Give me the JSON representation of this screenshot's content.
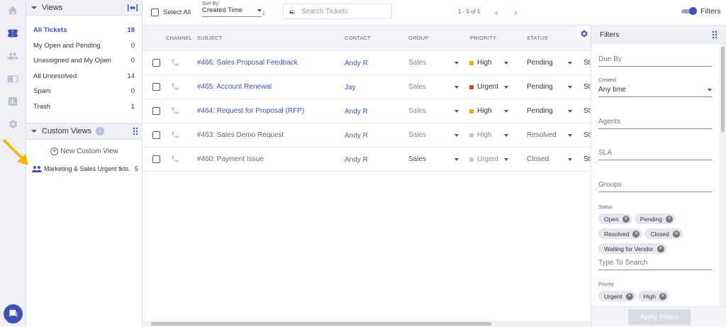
{
  "views": {
    "title": "Views",
    "items": [
      {
        "label": "All Tickets",
        "count": "18"
      },
      {
        "label": "My Open and Pending",
        "count": "0"
      },
      {
        "label": "Unassigned and My Open",
        "count": "0"
      },
      {
        "label": "All Unresolved",
        "count": "14"
      },
      {
        "label": "Spam",
        "count": "0"
      },
      {
        "label": "Trash",
        "count": "1"
      }
    ]
  },
  "custom_views": {
    "title": "Custom Views",
    "info": "i",
    "new_label": "New Custom View",
    "items": [
      {
        "label": "Marketing & Sales Urgent tkts.",
        "count": "5"
      }
    ]
  },
  "toolbar": {
    "select_all": "Select All",
    "sort_caption": "Sort By:",
    "sort_value": "Created Time",
    "sort_direction": "↓",
    "search_placeholder": "Search Tickets",
    "pager": "1 - 5 of 5",
    "prev": "‹",
    "next": "›",
    "filters_label": "Filters"
  },
  "table": {
    "headers": {
      "channel": "CHANNEL",
      "subject": "SUBJECT",
      "contact": "CONTACT",
      "group": "GROUP",
      "priority": "PRIORITY",
      "status": "STATUS"
    },
    "rows": [
      {
        "subject": "#466: Sales Proposal Feedback",
        "contact": "Andy R",
        "group": "Sales",
        "priority": "High",
        "priority_color": "#f5a623",
        "status": "Pending",
        "stcut": "Sta",
        "resolved": false
      },
      {
        "subject": "#465: Account Renewal",
        "contact": "Jay",
        "group": "Sales",
        "priority": "Urgent",
        "priority_color": "#e53935",
        "status": "Pending",
        "stcut": "Sta",
        "resolved": false
      },
      {
        "subject": "#464: Request for Proposal (RFP)",
        "contact": "Andy R",
        "group": "Sales",
        "priority": "High",
        "priority_color": "#f5a623",
        "status": "Pending",
        "stcut": "Sta",
        "resolved": false
      },
      {
        "subject": "#463: Sales Demo Request",
        "contact": "Andy R",
        "group": "Sales",
        "priority": "High",
        "priority_color": "#c8c8c8",
        "status": "Resolved",
        "stcut": "Sta",
        "resolved": true
      },
      {
        "subject": "#460: Payment Issue",
        "contact": "Andy R",
        "group": "Sales",
        "priority": "Urgent",
        "priority_color": "#c8c8c8",
        "status": "Closed",
        "stcut": "Sta",
        "resolved": true
      }
    ]
  },
  "filters": {
    "title": "Filters",
    "due_by": "Due By",
    "created_caption": "Created",
    "created_value": "Any time",
    "agents": "Agents",
    "sla": "SLA",
    "groups": "Groups",
    "status_caption": "Status",
    "status_chips": [
      "Open",
      "Pending",
      "Resolved",
      "Closed",
      "Waiting for Vendor"
    ],
    "status_search": "Type To Search",
    "priority_caption": "Priority",
    "priority_chips": [
      "Urgent",
      "High"
    ],
    "apply": "Apply Filters"
  },
  "colors": {
    "accent": "#3f51b5",
    "annotation_arrow": "#f2b705"
  }
}
